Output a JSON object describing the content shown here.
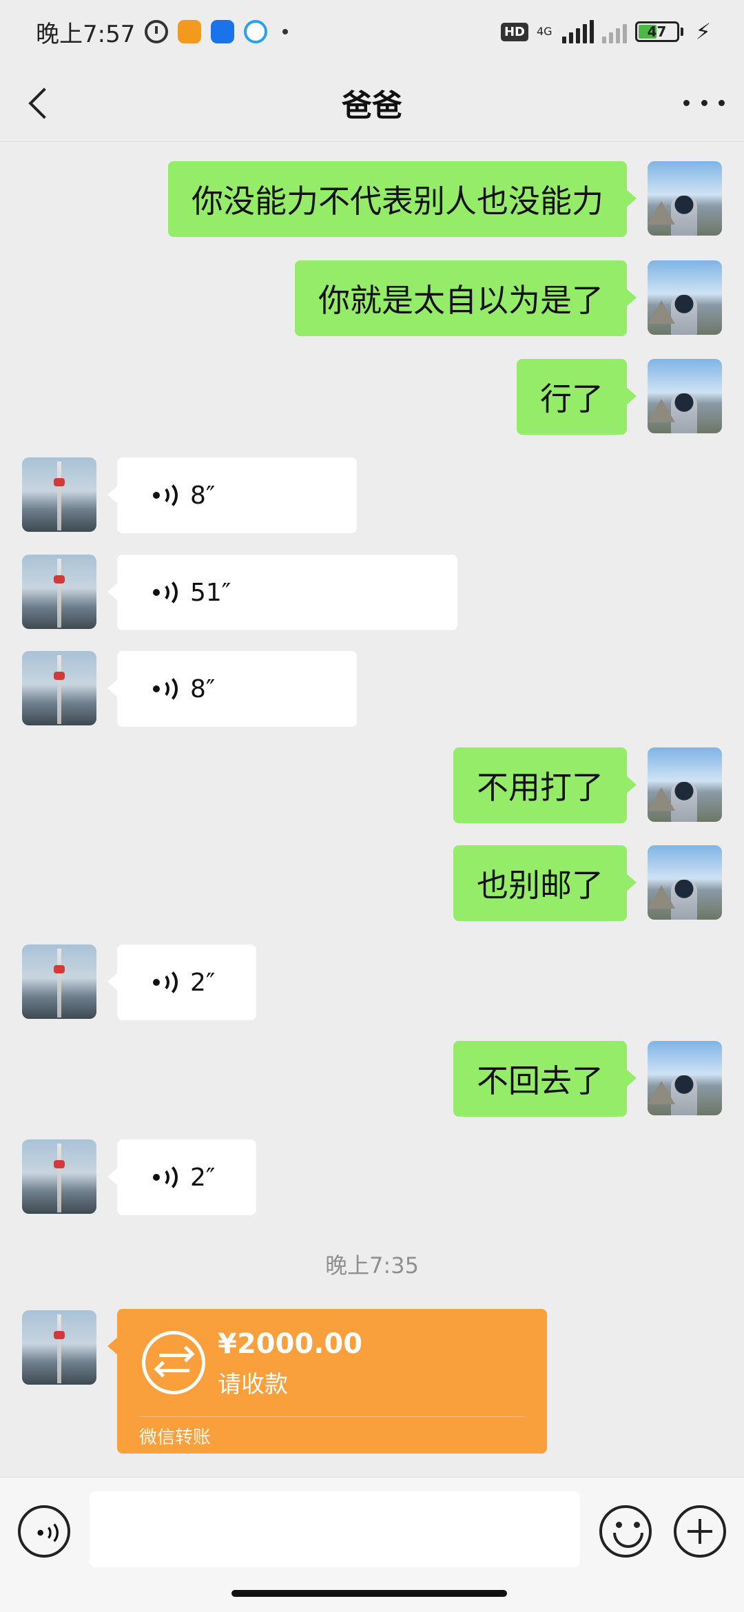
{
  "status_bar": {
    "time": "晚上7:57",
    "hd": "HD",
    "network": "4G",
    "battery": "47"
  },
  "nav": {
    "title": "爸爸"
  },
  "messages": [
    {
      "from": "me",
      "type": "text",
      "text": "你没能力不代表别人也没能力"
    },
    {
      "from": "me",
      "type": "text",
      "text": "你就是太自以为是了"
    },
    {
      "from": "me",
      "type": "text",
      "text": "行了"
    },
    {
      "from": "dad",
      "type": "voice",
      "duration": "8″"
    },
    {
      "from": "dad",
      "type": "voice",
      "duration": "51″"
    },
    {
      "from": "dad",
      "type": "voice",
      "duration": "8″"
    },
    {
      "from": "me",
      "type": "text",
      "text": "不用打了"
    },
    {
      "from": "me",
      "type": "text",
      "text": "也别邮了"
    },
    {
      "from": "dad",
      "type": "voice",
      "duration": "2″"
    },
    {
      "from": "me",
      "type": "text",
      "text": "不回去了"
    },
    {
      "from": "dad",
      "type": "voice",
      "duration": "2″"
    }
  ],
  "time_divider": "晚上7:35",
  "transfer": {
    "amount": "¥2000.00",
    "status": "请收款",
    "footer": "微信转账"
  },
  "input": {
    "placeholder": ""
  },
  "colors": {
    "my_bubble": "#95ec69",
    "their_bubble": "#ffffff",
    "transfer_card": "#f9a03c",
    "background": "#ededed"
  }
}
